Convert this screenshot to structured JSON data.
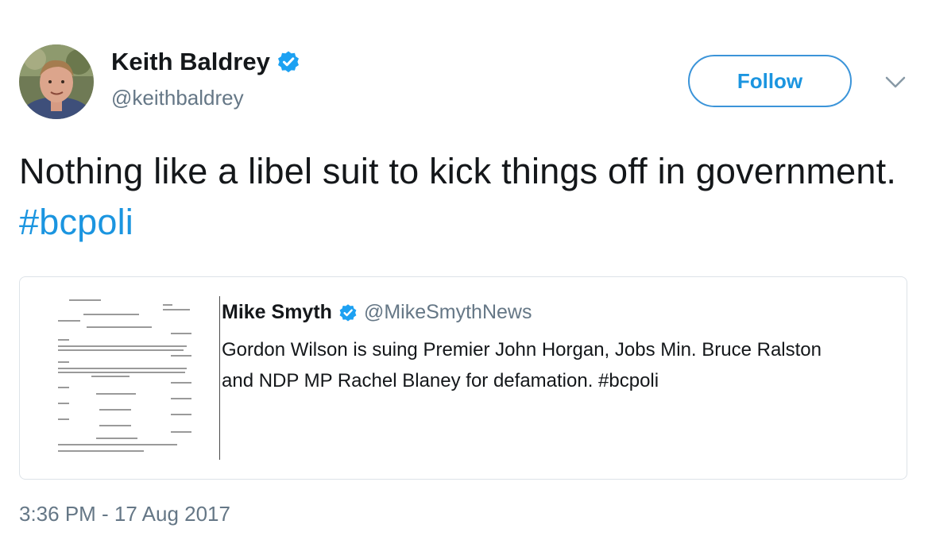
{
  "author": {
    "name": "Keith Baldrey",
    "handle": "@keithbaldrey",
    "verified": true,
    "avatar_icon": "person-photo-avatar"
  },
  "follow_button": {
    "label": "Follow"
  },
  "menu": {
    "icon": "chevron-down-icon"
  },
  "tweet": {
    "text": "Nothing like a libel suit to kick things off in government. ",
    "hashtag": "#bcpoli",
    "timestamp": "3:36 PM - 17 Aug 2017"
  },
  "quoted_tweet": {
    "author_name": "Mike Smyth",
    "author_handle": "@MikeSmythNews",
    "verified": true,
    "text": "Gordon Wilson is suing Premier John Horgan, Jobs Min. Bruce Ralston and NDP MP Rachel Blaney for defamation. #bcpoli",
    "thumbnail_icon": "legal-document-thumbnail"
  },
  "colors": {
    "accent": "#1b95e0",
    "secondary_text": "#657786",
    "border": "#dde3e8",
    "text": "#14171a"
  }
}
